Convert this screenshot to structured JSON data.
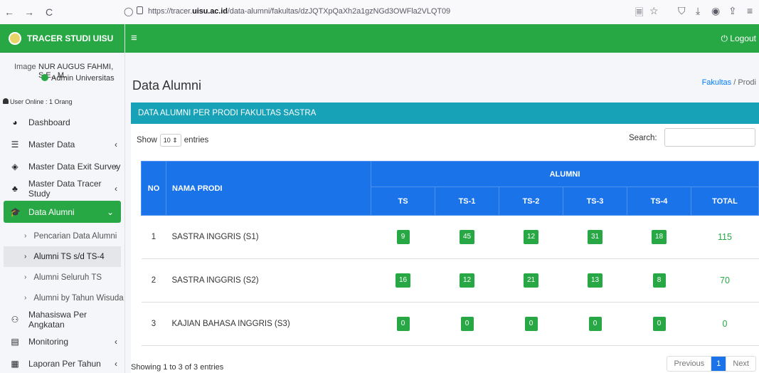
{
  "browser": {
    "url_prefix": "https://tracer.",
    "url_domain": "uisu.ac.id",
    "url_path": "/data-alumni/fakultas/dzJQTXpQaXh2a1gzNGd3OWFla2VLQT09",
    "back": "←",
    "forward": "→",
    "reload": "C",
    "reader": "🗏",
    "star": "☆",
    "pocket": "⛉",
    "download": "⤓",
    "account": "◉",
    "extension": "⇪",
    "menu": "≡"
  },
  "brand": {
    "title": "TRACER STUDI UISU"
  },
  "user": {
    "image_alt": "Image",
    "name": "NUR AUGUS FAHMI, S.E., M.",
    "role": "Admin Universitas",
    "online": "User Online : 1 Orang"
  },
  "sidebar": {
    "items": [
      {
        "label": "Dashboard",
        "icon": "dashboard-icon",
        "glyph": "◕"
      },
      {
        "label": "Master Data",
        "icon": "database-icon",
        "glyph": "☰",
        "chev": "‹"
      },
      {
        "label": "Master Data Exit Survey",
        "icon": "survey-icon",
        "glyph": "◈",
        "chev": "‹"
      },
      {
        "label": "Master Data Tracer Study",
        "icon": "tracer-icon",
        "glyph": "♣",
        "chev": "‹"
      },
      {
        "label": "Data Alumni",
        "icon": "graduation-cap-icon",
        "glyph": "🎓",
        "chev": "⌄"
      }
    ],
    "subitems": [
      {
        "label": "Pencarian Data Alumni"
      },
      {
        "label": "Alumni TS s/d TS-4"
      },
      {
        "label": "Alumni Seluruh TS"
      },
      {
        "label": "Alumni by Tahun Wisuda"
      }
    ],
    "bottom_items": [
      {
        "label": "Mahasiswa Per Angkatan",
        "icon": "users-icon",
        "glyph": "⚇"
      },
      {
        "label": "Monitoring",
        "icon": "list-icon",
        "glyph": "▤",
        "chev": "‹"
      },
      {
        "label": "Laporan Per Tahun",
        "icon": "calendar-icon",
        "glyph": "▦",
        "chev": "‹"
      }
    ]
  },
  "topbar": {
    "menu_glyph": "≡",
    "logout": "⏻ Logout"
  },
  "page": {
    "title": "Data Alumni",
    "breadcrumb_link": "Fakultas",
    "breadcrumb_sep": " / ",
    "breadcrumb_current": "Prodi"
  },
  "card": {
    "header": "DATA ALUMNI PER PRODI FAKULTAS SASTRA",
    "show_label": "Show",
    "entries_value": "10",
    "entries_label": "entries",
    "search_label": "Search:"
  },
  "table": {
    "headers": {
      "no": "NO",
      "prodi": "NAMA PRODI",
      "alumni": "ALUMNI"
    },
    "columns": [
      "TS",
      "TS-1",
      "TS-2",
      "TS-3",
      "TS-4",
      "TOTAL"
    ],
    "rows": [
      {
        "no": "1",
        "prodi": "SASTRA INGGRIS (S1)",
        "vals": [
          "9",
          "45",
          "12",
          "31",
          "18"
        ],
        "total": "115"
      },
      {
        "no": "2",
        "prodi": "SASTRA INGGRIS (S2)",
        "vals": [
          "16",
          "12",
          "21",
          "13",
          "8"
        ],
        "total": "70"
      },
      {
        "no": "3",
        "prodi": "KAJIAN BAHASA INGGRIS (S3)",
        "vals": [
          "0",
          "0",
          "0",
          "0",
          "0"
        ],
        "total": "0"
      }
    ]
  },
  "footer": {
    "info": "Showing 1 to 3 of 3 entries",
    "prev": "Previous",
    "page": "1",
    "next": "Next"
  },
  "colors": {
    "green": "#28a745",
    "teal": "#17a2b8",
    "blue": "#1a73e8"
  }
}
